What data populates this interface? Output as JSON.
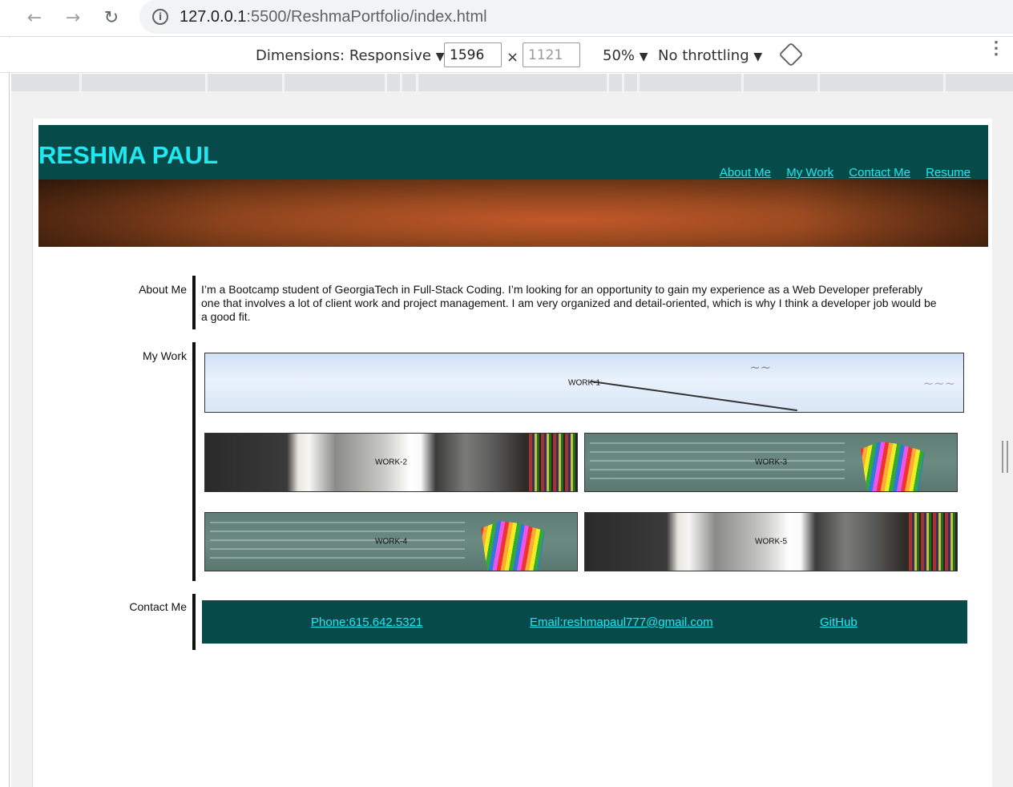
{
  "browser": {
    "url_host": "127.0.0.1",
    "url_rest": ":5500/ReshmaPortfolio/index.html"
  },
  "devtools": {
    "dimensions_label": "Dimensions: Responsive",
    "width_value": "1596",
    "times_symbol": "×",
    "height_value": "1121",
    "zoom": "50%",
    "throttling": "No throttling",
    "dropdown_arrow": "▼"
  },
  "site": {
    "title": "RESHMA PAUL",
    "nav": [
      "About Me",
      "My Work",
      "Contact Me",
      "Resume"
    ],
    "about_label": "About Me",
    "about_text": "I’m a Bootcamp student of GeorgiaTech in Full-Stack Coding. I’m looking for an opportunity to gain my experience as a Web Developer preferably one that involves a lot of client work and project management. I am very organized and detail-oriented, which is why I think a developer job would be a good fit.",
    "work_label": "My Work",
    "works": [
      "WORK-1",
      "WORK-2",
      "WORK-3",
      "WORK-4",
      "WORK-5"
    ],
    "contact_label": "Contact Me",
    "contact_links": [
      "Phone:615.642.5321",
      "Email:reshmapaul777@gmail.com",
      "GitHub"
    ]
  },
  "colors": {
    "header_bg": "#064a4a",
    "accent_cyan": "#1fe9f0"
  }
}
